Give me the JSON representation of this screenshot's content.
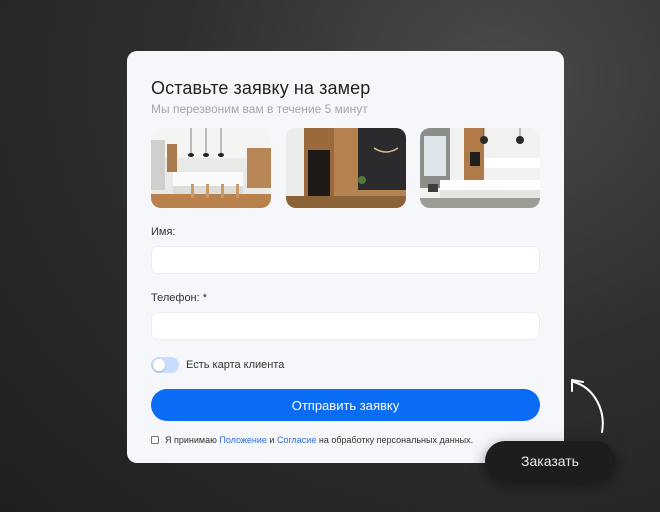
{
  "modal": {
    "title": "Оставьте заявку на замер",
    "subtitle": "Мы перезвоним вам в течение 5 минут",
    "photos": [
      {
        "icon": "kitchen-photo-1"
      },
      {
        "icon": "kitchen-photo-2"
      },
      {
        "icon": "kitchen-photo-3"
      }
    ],
    "name_label": "Имя:",
    "name_value": "",
    "phone_label": "Телефон: *",
    "phone_value": "",
    "toggle_label": "Есть карта клиента",
    "toggle_on": false,
    "submit_label": "Отправить заявку",
    "consent": {
      "checked": false,
      "prefix": "Я принимаю ",
      "link1": "Положение",
      "middle": " и ",
      "link2": "Согласие",
      "suffix": " на обработку персональных данных."
    }
  },
  "order_button_label": "Заказать",
  "colors": {
    "accent": "#0a6cf5",
    "toggle_track": "#c9dcff",
    "link": "#2f6de0",
    "order_button": "#1d1d1d"
  }
}
